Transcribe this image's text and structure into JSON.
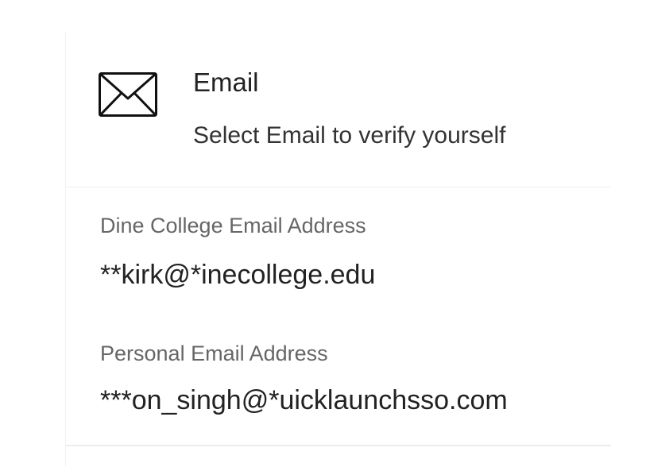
{
  "method": {
    "icon": "envelope-icon",
    "title": "Email",
    "subtitle": "Select Email to verify yourself"
  },
  "fields": [
    {
      "label": "Dine College Email Address",
      "value": "**kirk@*inecollege.edu"
    },
    {
      "label": "Personal Email Address",
      "value": "***on_singh@*uicklaunchsso.com"
    }
  ]
}
